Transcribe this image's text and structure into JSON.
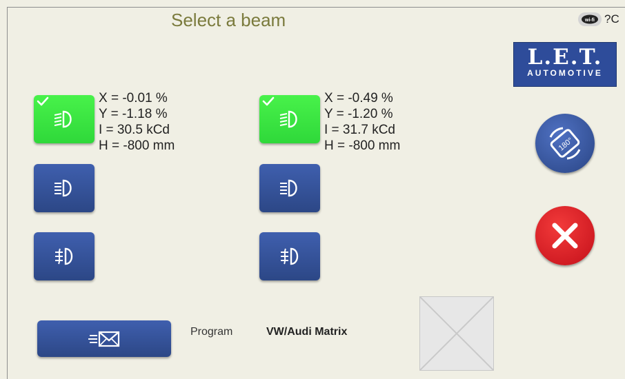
{
  "header": {
    "title": "Select a beam",
    "status_text": "?C",
    "wifi_badge_text": "wi-fi"
  },
  "logo": {
    "main": "L.E.T.",
    "sub": "AUTOMOTIVE"
  },
  "left_lamp": {
    "readouts": [
      "X = -0.01 %",
      "Y = -1.18 %",
      "I = 30.5 kCd",
      "H = -800 mm"
    ],
    "buttons": [
      {
        "icon": "low-beam-icon",
        "active": true
      },
      {
        "icon": "high-beam-icon",
        "active": false
      },
      {
        "icon": "fog-light-icon",
        "active": false
      }
    ]
  },
  "right_lamp": {
    "readouts": [
      "X = -0.49 %",
      "Y = -1.20 %",
      "I = 31.7 kCd",
      "H = -800 mm"
    ],
    "buttons": [
      {
        "icon": "low-beam-icon",
        "active": true
      },
      {
        "icon": "high-beam-icon",
        "active": false
      },
      {
        "icon": "fog-light-icon",
        "active": false
      }
    ]
  },
  "side_actions": [
    {
      "icon": "rotate-180-icon",
      "rotate_label": "180°"
    },
    {
      "icon": "close-icon"
    }
  ],
  "footer": {
    "send_icon": "send-mail-icon",
    "program_label": "Program",
    "program_value": "VW/Audi Matrix"
  },
  "colors": {
    "background": "#f0efe4",
    "button_blue": "#2e4c9a",
    "active_green": "#3ae73f",
    "cancel_red": "#d9161f",
    "title": "#7a7a3c"
  }
}
